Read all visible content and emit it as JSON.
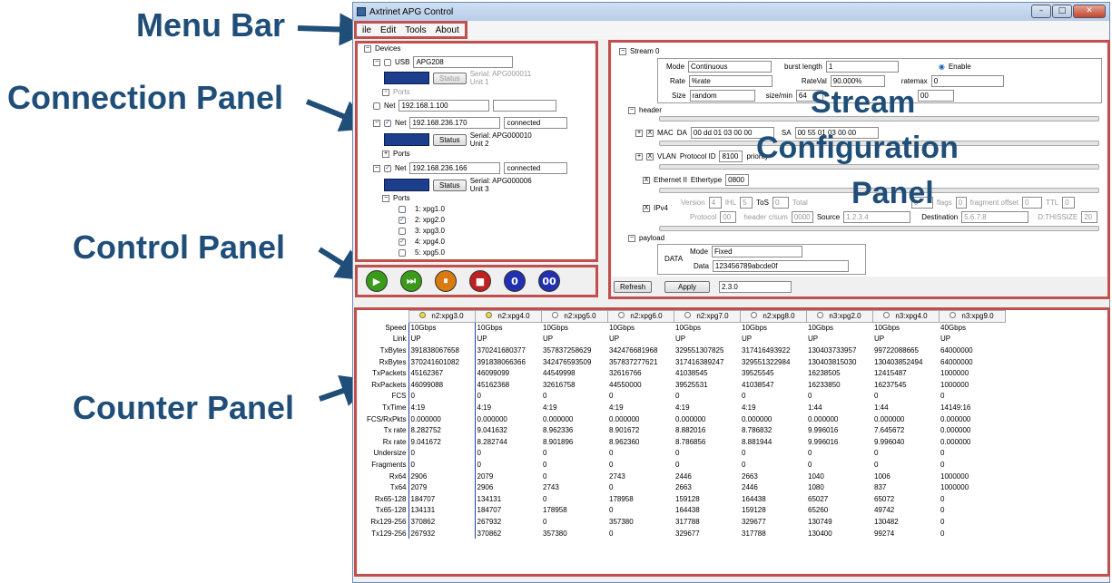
{
  "annotations": {
    "menu_bar": "Menu Bar",
    "connection_panel": "Connection Panel",
    "control_panel": "Control Panel",
    "counter_panel": "Counter Panel",
    "stream_config": [
      "Stream",
      "Configuration",
      "Panel"
    ]
  },
  "window": {
    "title": "Axtrinet APG Control"
  },
  "menu": [
    "ile",
    "Edit",
    "Tools",
    "About"
  ],
  "connection": {
    "root": "Devices",
    "usb": {
      "label": "USB",
      "name": "APG208",
      "status": "Status",
      "serial": "Serial: APG000011",
      "unit": "Unit 1",
      "ports": "Ports"
    },
    "net1": {
      "label": "Net",
      "ip": "192.168.1.100",
      "state": ""
    },
    "net2": {
      "label": "Net",
      "ip": "192.168.236.170",
      "state": "connected",
      "status": "Status",
      "serial": "Serial: APG000010",
      "unit": "Unit 2",
      "ports": "Ports"
    },
    "net3": {
      "label": "Net",
      "ip": "192.168.236.166",
      "state": "connected",
      "status": "Status",
      "serial": "Serial: APG000006",
      "unit": "Unit 3",
      "ports": "Ports"
    },
    "port_list": [
      {
        "label": "1: xpg1.0",
        "checked": false
      },
      {
        "label": "2: xpg2.0",
        "checked": true
      },
      {
        "label": "3: xpg3.0",
        "checked": false
      },
      {
        "label": "4: xpg4.0",
        "checked": true
      },
      {
        "label": "5: xpg5.0",
        "checked": false
      }
    ]
  },
  "controls": [
    {
      "name": "play-icon",
      "glyph": "▶",
      "color": "#3a9a1a"
    },
    {
      "name": "step-icon",
      "glyph": "⏭",
      "color": "#3a9a1a"
    },
    {
      "name": "pause-icon",
      "glyph": "⏸",
      "color": "#d97a10"
    },
    {
      "name": "stop-icon",
      "glyph": "■",
      "color": "#c02020"
    },
    {
      "name": "clear-counter-icon",
      "glyph": "0",
      "color": "#2030b0"
    },
    {
      "name": "clear-all-icon",
      "glyph": "00",
      "color": "#2030b0"
    }
  ],
  "stream": {
    "root": "Stream 0",
    "mode_label": "Mode",
    "mode": "Continuous",
    "burst_label": "burst length",
    "burst": "1",
    "enable": "Enable",
    "rate_label": "Rate",
    "rate": "%rate",
    "rateval_label": "RateVal",
    "rateval": "90.000%",
    "ratemax_label": "ratemax",
    "ratemax": "0",
    "size_label": "Size",
    "size": "random",
    "sizemin_label": "size/min",
    "sizemin": "64",
    "sizemax": "00",
    "header": "header",
    "insert": "---------- insert ----------",
    "mac": {
      "label": "MAC",
      "da_label": "DA",
      "da": "00 dd 01 03 00 00",
      "sa_label": "SA",
      "sa": "00 55 01 03 00 00"
    },
    "vlan": {
      "label": "VLAN",
      "pid_label": "Protocol ID",
      "pid": "8100",
      "prio_label": "priority"
    },
    "eth": {
      "label": "Ethernet II",
      "et_label": "Ethertype",
      "et": "0800"
    },
    "ipv4": {
      "label": "IPv4",
      "version_label": "Version",
      "version": "4",
      "ihl_label": "IHL",
      "ihl": "5",
      "tos_label": "ToS",
      "tos": "0",
      "total_label": "Total",
      "flags_label": "flags",
      "flags": "0",
      "frag_label": "fragment offset",
      "frag": "0",
      "ttl_label": "TTL",
      "ttl": "0",
      "proto_label": "Protocol",
      "proto": "00",
      "csum_label": "header c/sum",
      "csum": "0000",
      "src_label": "Source",
      "src": "1.2.3.4",
      "dst_label": "Destination",
      "dst": "5.6.7.8",
      "thissize": "D:THISSIZE",
      "thissize_val": "20",
      "idfield": "0"
    },
    "payload": "payload",
    "data_label": "DATA",
    "pmode_label": "Mode",
    "pmode": "Fixed",
    "pdata_label": "Data",
    "pdata": "123456789abcde0f",
    "refresh": "Refresh",
    "apply": "Apply",
    "version": "2.3.0"
  },
  "counters": {
    "columns": [
      "n2:xpg3.0",
      "n2:xpg4.0",
      "n2:xpg5.0",
      "n2:xpg6.0",
      "n2:xpg7.0",
      "n2:xpg8.0",
      "n3:xpg2.0",
      "n3:xpg4.0",
      "n3:xpg9.0"
    ],
    "rows": [
      {
        "label": "Speed",
        "vals": [
          "10Gbps",
          "10Gbps",
          "10Gbps",
          "10Gbps",
          "10Gbps",
          "10Gbps",
          "10Gbps",
          "10Gbps",
          "40Gbps"
        ]
      },
      {
        "label": "Link",
        "vals": [
          "UP",
          "UP",
          "UP",
          "UP",
          "UP",
          "UP",
          "UP",
          "UP",
          "UP"
        ]
      },
      {
        "label": "TxBytes",
        "vals": [
          "391838067658",
          "370241680377",
          "357837258629",
          "342476681968",
          "329551307825",
          "317416493922",
          "130403733957",
          "99722088665",
          "64000000"
        ]
      },
      {
        "label": "RxBytes",
        "vals": [
          "370241601082",
          "391838066366",
          "342476593509",
          "357837277621",
          "317416389247",
          "329551322984",
          "130403815030",
          "130403852494",
          "64000000"
        ]
      },
      {
        "label": "TxPackets",
        "vals": [
          "45162367",
          "46099099",
          "44549998",
          "32616766",
          "41038545",
          "39525545",
          "16238505",
          "12415487",
          "1000000"
        ]
      },
      {
        "label": "RxPackets",
        "vals": [
          "46099088",
          "45162368",
          "32616758",
          "44550000",
          "39525531",
          "41038547",
          "16233850",
          "16237545",
          "1000000"
        ]
      },
      {
        "label": "FCS",
        "vals": [
          "0",
          "0",
          "0",
          "0",
          "0",
          "0",
          "0",
          "0",
          "0"
        ]
      },
      {
        "label": "TxTime",
        "vals": [
          "4:19",
          "4:19",
          "4:19",
          "4:19",
          "4:19",
          "4:19",
          "1:44",
          "1:44",
          "14149:16"
        ]
      },
      {
        "label": "FCS/RxPkts",
        "vals": [
          "0.000000",
          "0.000000",
          "0.000000",
          "0.000000",
          "0.000000",
          "0.000000",
          "0.000000",
          "0.000000",
          "0.000000"
        ]
      },
      {
        "label": "Tx rate",
        "vals": [
          "8.282752",
          "9.041632",
          "8.962336",
          "8.901672",
          "8.882016",
          "8.786832",
          "9.996016",
          "7.645672",
          "0.000000"
        ]
      },
      {
        "label": "Rx rate",
        "vals": [
          "9.041672",
          "8.282744",
          "8.901896",
          "8.962360",
          "8.786856",
          "8.881944",
          "9.996016",
          "9.996040",
          "0.000000"
        ]
      },
      {
        "label": "Undersize",
        "vals": [
          "0",
          "0",
          "0",
          "0",
          "0",
          "0",
          "0",
          "0",
          "0"
        ]
      },
      {
        "label": "Fragments",
        "vals": [
          "0",
          "0",
          "0",
          "0",
          "0",
          "0",
          "0",
          "0",
          "0"
        ]
      },
      {
        "label": "Rx64",
        "vals": [
          "2906",
          "2079",
          "0",
          "2743",
          "2446",
          "2663",
          "1040",
          "1006",
          "1000000"
        ]
      },
      {
        "label": "Tx64",
        "vals": [
          "2079",
          "2906",
          "2743",
          "0",
          "2663",
          "2446",
          "1080",
          "837",
          "1000000"
        ]
      },
      {
        "label": "Rx65-128",
        "vals": [
          "184707",
          "134131",
          "0",
          "178958",
          "159128",
          "164438",
          "65027",
          "65072",
          "0"
        ]
      },
      {
        "label": "Tx65-128",
        "vals": [
          "134131",
          "184707",
          "178958",
          "0",
          "164438",
          "159128",
          "65260",
          "49742",
          "0"
        ]
      },
      {
        "label": "Rx129-256",
        "vals": [
          "370862",
          "267932",
          "0",
          "357380",
          "317788",
          "329677",
          "130749",
          "130482",
          "0"
        ]
      },
      {
        "label": "Tx129-256",
        "vals": [
          "267932",
          "370862",
          "357380",
          "0",
          "329677",
          "317788",
          "130400",
          "99274",
          "0"
        ]
      }
    ]
  }
}
